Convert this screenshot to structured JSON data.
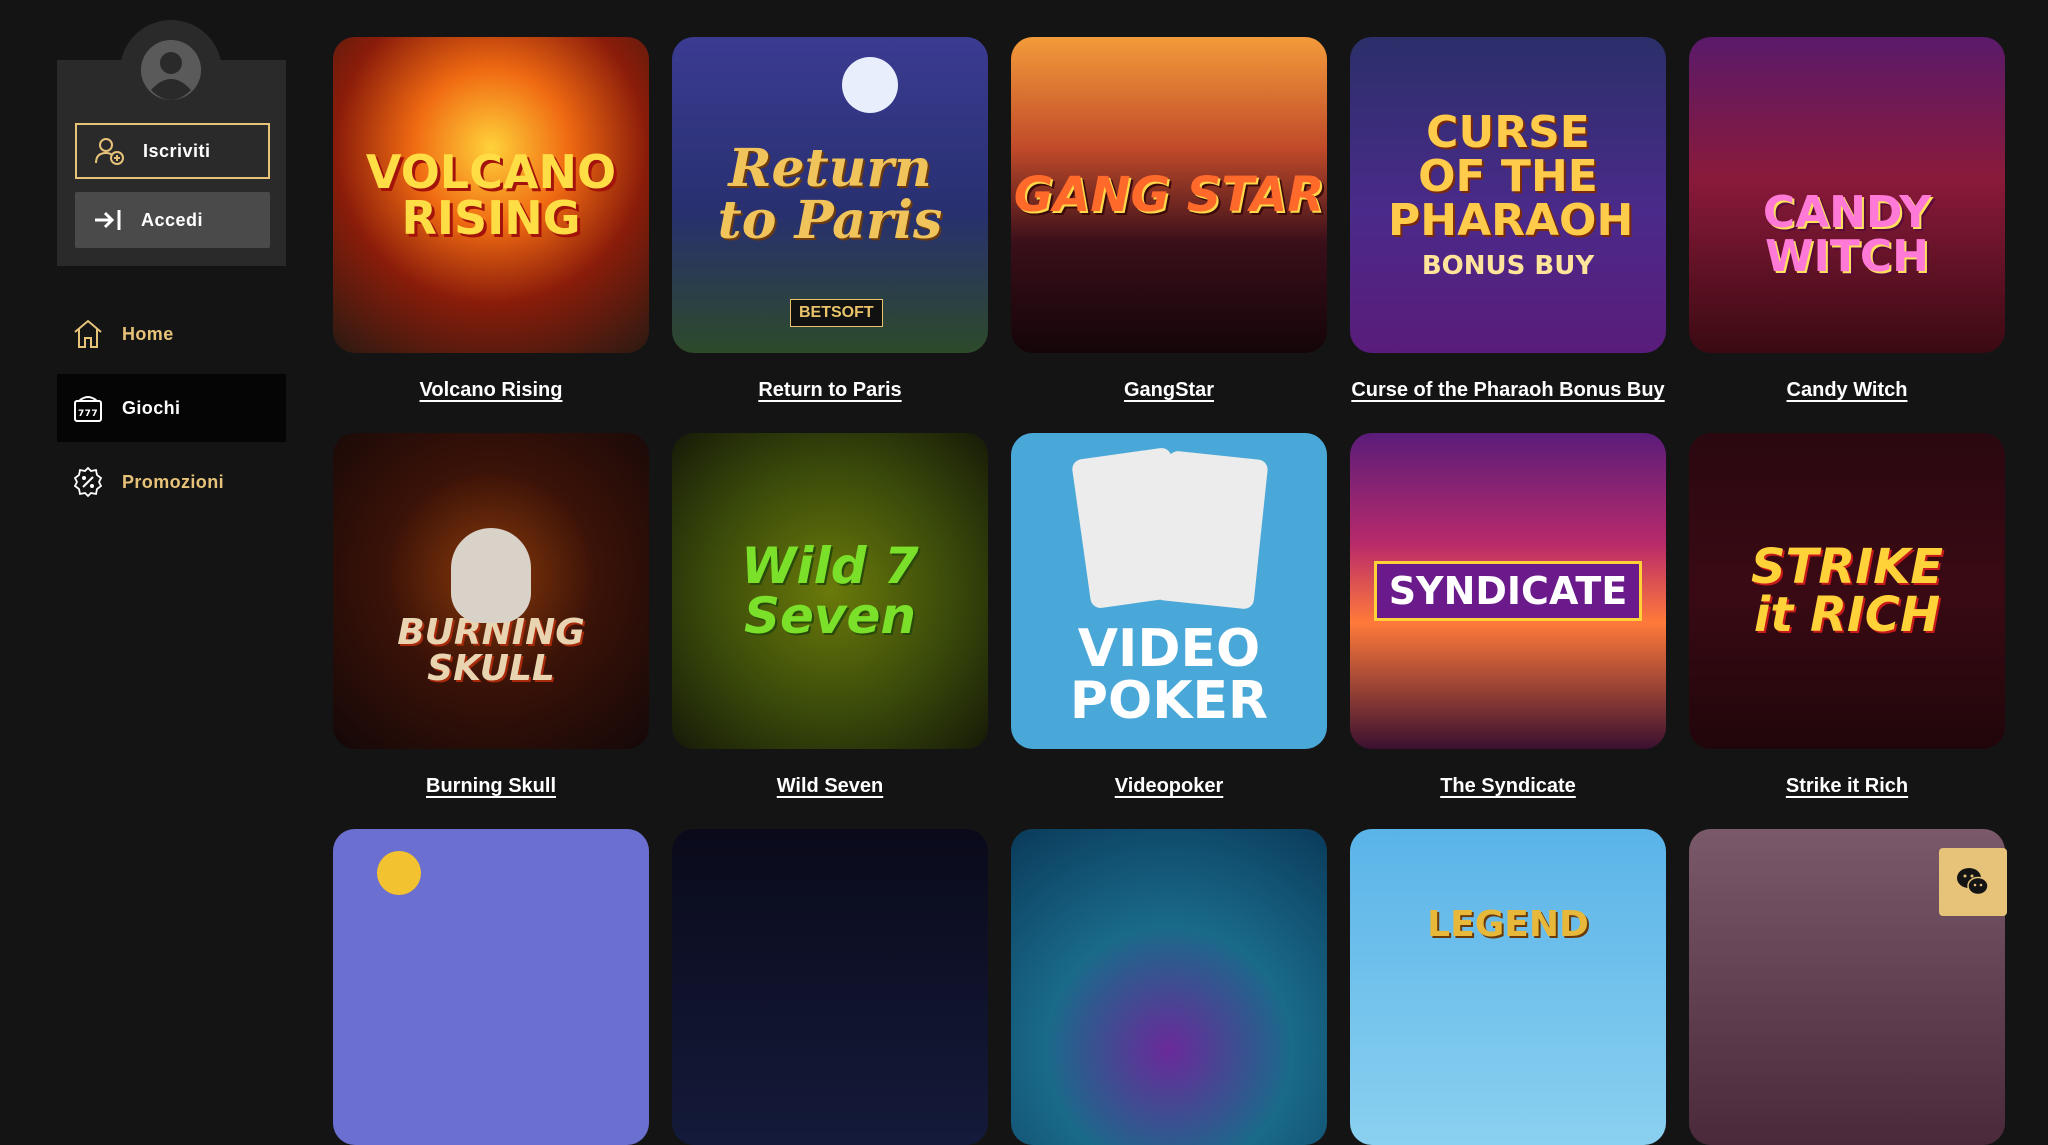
{
  "sidebar": {
    "register_label": "Iscriviti",
    "login_label": "Accedi",
    "nav": [
      {
        "label": "Home",
        "icon": "home-icon"
      },
      {
        "label": "Giochi",
        "icon": "slot-777-icon"
      },
      {
        "label": "Promozioni",
        "icon": "percent-badge-icon"
      }
    ]
  },
  "games": [
    {
      "title": "Volcano Rising",
      "art": "VOLCANO\nRISING"
    },
    {
      "title": "Return to Paris",
      "art": "Return to Paris",
      "badge": "BETSOFT"
    },
    {
      "title": "GangStar",
      "art": "GANG STAR"
    },
    {
      "title": "Curse of the Pharaoh Bonus Buy",
      "art": "CURSE OF THE PHARAOH",
      "subart": "BONUS BUY"
    },
    {
      "title": "Candy Witch",
      "art": "CANDY WITCH"
    },
    {
      "title": "Burning Skull",
      "art": "BURNING SKULL"
    },
    {
      "title": "Wild Seven",
      "art": "Wild 7 Seven"
    },
    {
      "title": "Videopoker",
      "art": "VIDEO POKER"
    },
    {
      "title": "The Syndicate",
      "art": "SYNDICATE"
    },
    {
      "title": "Strike it Rich",
      "art": "STRIKE it RICH"
    },
    {
      "title": "",
      "art": ""
    },
    {
      "title": "",
      "art": ""
    },
    {
      "title": "",
      "art": ""
    },
    {
      "title": "",
      "art": "LEGEND"
    },
    {
      "title": "",
      "art": ""
    }
  ],
  "colors": {
    "accent": "#e7c37a",
    "background": "#141414",
    "panel": "#2a2a2a"
  },
  "chat_icon": "wechat-icon"
}
